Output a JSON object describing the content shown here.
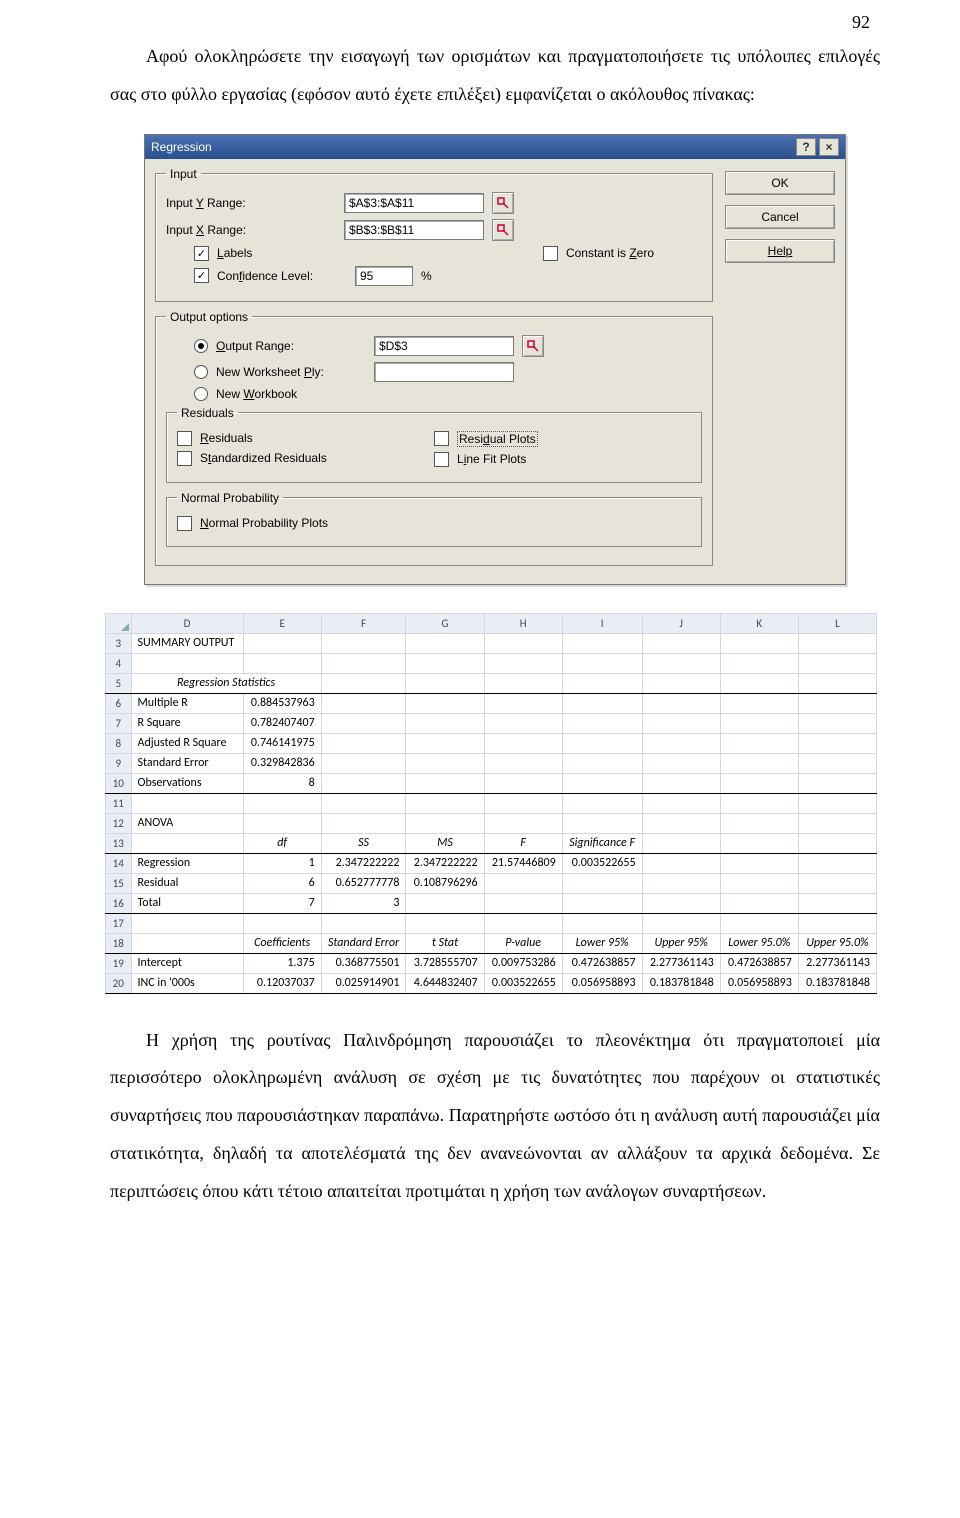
{
  "page_number": "92",
  "para1": "Αφού ολοκληρώσετε την εισαγωγή των ορισμάτων και πραγματοποιήσετε τις υπόλοιπες επιλογές σας στο φύλλο εργασίας (εφόσον αυτό έχετε επιλέξει) εμφανίζεται ο ακόλουθος πίνακας:",
  "para2": "Η χρήση της ρουτίνας Παλινδρόμηση παρουσιάζει το πλεονέκτημα ότι πραγματοποιεί μία περισσότερο ολοκληρωμένη ανάλυση σε σχέση με τις δυνατότητες που παρέχουν οι στατιστικές συναρτήσεις που παρουσιάστηκαν παραπάνω.  Παρατηρήστε ωστόσο ότι η ανάλυση αυτή παρουσιάζει μία στατικότητα, δηλαδή τα αποτελέσματά της δεν ανανεώνονται αν αλλάξουν τα αρχικά δεδομένα.  Σε περιπτώσεις όπου κάτι τέτοιο απαιτείται προτιμάται η χρήση των ανάλογων συναρτήσεων.",
  "dialog": {
    "title": "Regression",
    "buttons": {
      "ok": "OK",
      "cancel": "Cancel",
      "help": "Help"
    },
    "input": {
      "legend": "Input",
      "y_label_pre": "Input ",
      "y_label_u": "Y",
      "y_label_post": " Range:",
      "x_label_pre": "Input ",
      "x_label_u": "X",
      "x_label_post": " Range:",
      "y_value": "$A$3:$A$11",
      "x_value": "$B$3:$B$11",
      "labels_u": "L",
      "labels_post": "abels",
      "constzero_pre": "Constant is ",
      "constzero_u": "Z",
      "constzero_post": "ero",
      "conf_pre": "Con",
      "conf_u": "f",
      "conf_post": "idence Level:",
      "conf_value": "95",
      "conf_unit": "%"
    },
    "output": {
      "legend": "Output options",
      "range_u": "O",
      "range_post": "utput Range:",
      "range_value": "$D$3",
      "newws_pre": "New Worksheet ",
      "newws_u": "P",
      "newws_post": "ly:",
      "newwb_pre": "New ",
      "newwb_u": "W",
      "newwb_post": "orkbook",
      "residuals_legend": "Residuals",
      "res_u": "R",
      "res_post": "esiduals",
      "std_pre": "S",
      "std_u": "t",
      "std_post": "andardized Residuals",
      "resplot_pre": "Resi",
      "resplot_u": "d",
      "resplot_post": "ual Plots",
      "linefit_pre": "L",
      "linefit_u": "i",
      "linefit_post": "ne Fit Plots",
      "normal_legend": "Normal Probability",
      "normal_u": "N",
      "normal_post": "ormal Probability Plots"
    }
  },
  "sheet": {
    "cols": [
      "D",
      "E",
      "F",
      "G",
      "H",
      "I",
      "J",
      "K",
      "L"
    ],
    "rows": {
      "3": [
        "SUMMARY OUTPUT",
        "",
        "",
        "",
        "",
        "",
        "",
        "",
        ""
      ],
      "4": [
        "",
        "",
        "",
        "",
        "",
        "",
        "",
        "",
        ""
      ],
      "5": [
        "Regression Statistics",
        "",
        "",
        "",
        "",
        "",
        "",
        "",
        ""
      ],
      "6": [
        "Multiple R",
        "0.884537963",
        "",
        "",
        "",
        "",
        "",
        "",
        ""
      ],
      "7": [
        "R Square",
        "0.782407407",
        "",
        "",
        "",
        "",
        "",
        "",
        ""
      ],
      "8": [
        "Adjusted R Square",
        "0.746141975",
        "",
        "",
        "",
        "",
        "",
        "",
        ""
      ],
      "9": [
        "Standard Error",
        "0.329842836",
        "",
        "",
        "",
        "",
        "",
        "",
        ""
      ],
      "10": [
        "Observations",
        "8",
        "",
        "",
        "",
        "",
        "",
        "",
        ""
      ],
      "11": [
        "",
        "",
        "",
        "",
        "",
        "",
        "",
        "",
        ""
      ],
      "12": [
        "ANOVA",
        "",
        "",
        "",
        "",
        "",
        "",
        "",
        ""
      ],
      "13": [
        "",
        "df",
        "SS",
        "MS",
        "F",
        "Significance F",
        "",
        "",
        ""
      ],
      "14": [
        "Regression",
        "1",
        "2.347222222",
        "2.347222222",
        "21.57446809",
        "0.003522655",
        "",
        "",
        ""
      ],
      "15": [
        "Residual",
        "6",
        "0.652777778",
        "0.108796296",
        "",
        "",
        "",
        "",
        ""
      ],
      "16": [
        "Total",
        "7",
        "3",
        "",
        "",
        "",
        "",
        "",
        ""
      ],
      "17": [
        "",
        "",
        "",
        "",
        "",
        "",
        "",
        "",
        ""
      ],
      "18": [
        "",
        "Coefficients",
        "Standard Error",
        "t Stat",
        "P-value",
        "Lower 95%",
        "Upper 95%",
        "Lower 95.0%",
        "Upper 95.0%"
      ],
      "19": [
        "Intercept",
        "1.375",
        "0.368775501",
        "3.728555707",
        "0.009753286",
        "0.472638857",
        "2.277361143",
        "0.472638857",
        "2.277361143"
      ],
      "20": [
        "INC in '000s",
        "0.12037037",
        "0.025914901",
        "4.644832407",
        "0.003522655",
        "0.056958893",
        "0.183781848",
        "0.056958893",
        "0.183781848"
      ]
    }
  }
}
